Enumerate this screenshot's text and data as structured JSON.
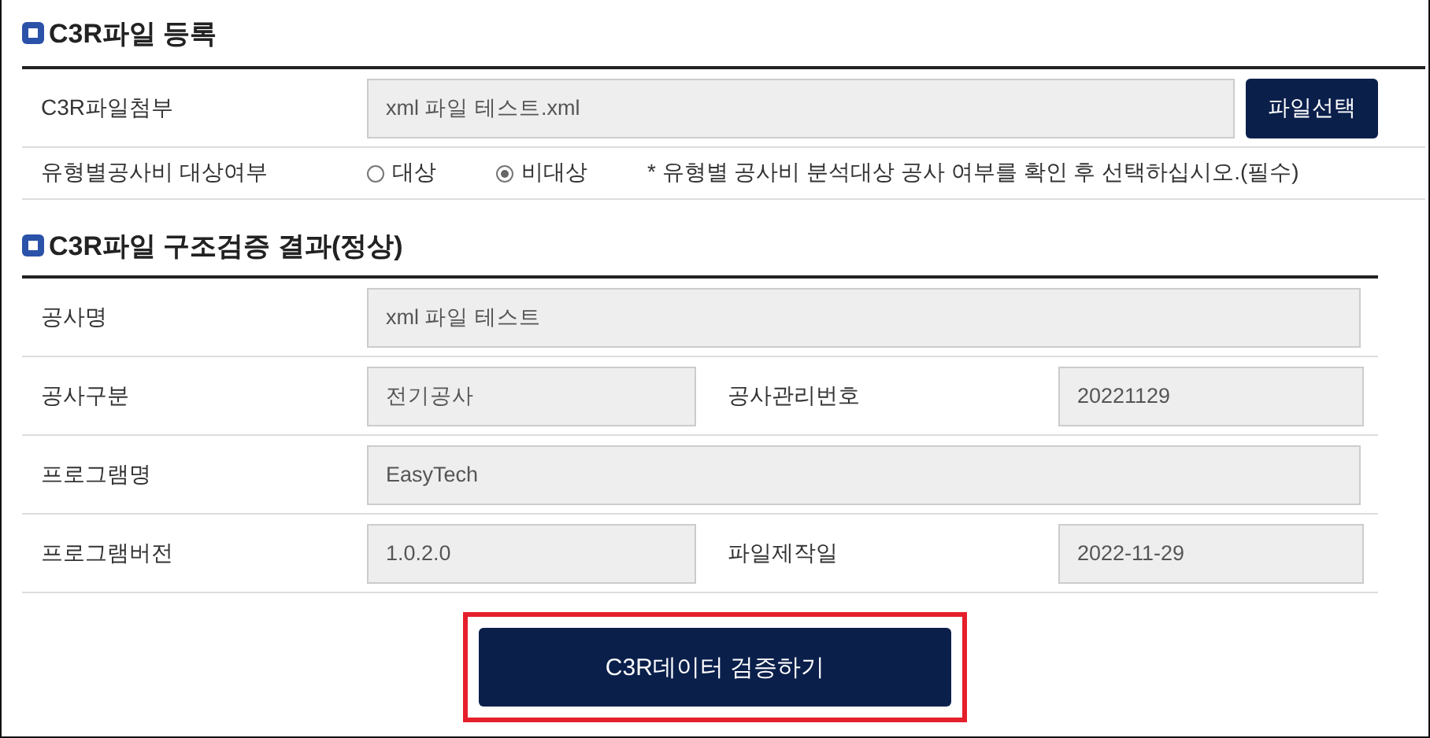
{
  "sections": [
    {
      "title": "C3R파일 등록",
      "rows": [
        {
          "kind": "file",
          "label": "C3R파일첨부",
          "value": "xml 파일 테스트.xml",
          "button": "파일선택"
        },
        {
          "kind": "radio",
          "label": "유형별공사비 대상여부",
          "options": [
            {
              "label": "대상",
              "selected": false
            },
            {
              "label": "비대상",
              "selected": true
            }
          ],
          "note": "* 유형별 공사비 분석대상 공사 여부를 확인 후 선택하십시오.(필수)"
        }
      ]
    },
    {
      "title": "C3R파일 구조검증 결과(정상)",
      "rows": [
        {
          "kind": "field",
          "label": "공사명",
          "value": "xml 파일 테스트"
        },
        {
          "kind": "pair",
          "fields": [
            {
              "label": "공사구분",
              "value": "전기공사"
            },
            {
              "label": "공사관리번호",
              "value": "20221129"
            }
          ]
        },
        {
          "kind": "field",
          "label": "프로그램명",
          "value": "EasyTech"
        },
        {
          "kind": "pair",
          "fields": [
            {
              "label": "프로그램버전",
              "value": "1.0.2.0"
            },
            {
              "label": "파일제작일",
              "value": "2022-11-29"
            }
          ]
        }
      ]
    }
  ],
  "submit": {
    "label": "C3R데이터 검증하기",
    "highlighted": true
  }
}
